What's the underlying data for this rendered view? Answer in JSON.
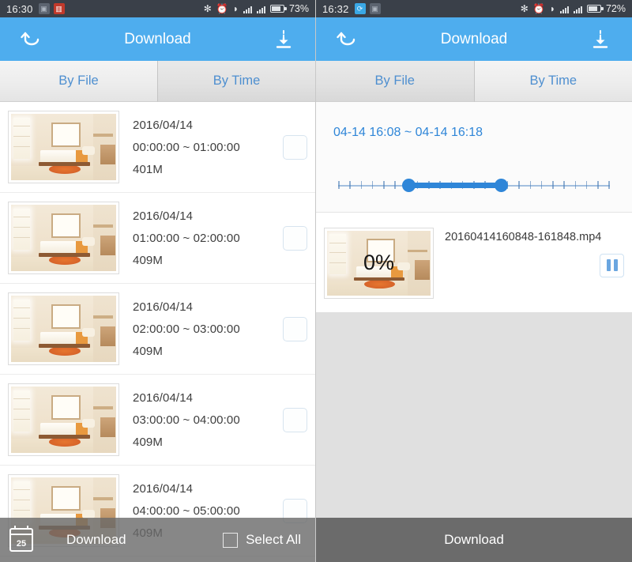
{
  "left": {
    "status_bar": {
      "time": "16:30",
      "icons": [
        "screenshot-icon",
        "calendar-icon"
      ],
      "right_icons": [
        "bluetooth-icon",
        "alarm-icon",
        "wifi-icon",
        "signal-icon",
        "signal-icon",
        "battery-icon"
      ],
      "battery_percent": "73%"
    },
    "header": {
      "back_icon": "back-arrow-icon",
      "title": "Download",
      "download_icon": "download-icon"
    },
    "tabs": [
      {
        "label": "By File",
        "selected": true
      },
      {
        "label": "By Time",
        "selected": false
      }
    ],
    "list": [
      {
        "date": "2016/04/14",
        "range": "00:00:00 ~ 01:00:00",
        "size": "401M",
        "checked": false
      },
      {
        "date": "2016/04/14",
        "range": "01:00:00 ~ 02:00:00",
        "size": "409M",
        "checked": false
      },
      {
        "date": "2016/04/14",
        "range": "02:00:00 ~ 03:00:00",
        "size": "409M",
        "checked": false
      },
      {
        "date": "2016/04/14",
        "range": "03:00:00 ~ 04:00:00",
        "size": "409M",
        "checked": false
      },
      {
        "date": "2016/04/14",
        "range": "04:00:00 ~ 05:00:00",
        "size": "409M",
        "checked": false
      }
    ],
    "bottom_bar": {
      "calendar_icon": "calendar-icon",
      "calendar_day": "25",
      "download_label": "Download",
      "select_all_label": "Select All",
      "select_all_checked": false
    }
  },
  "right": {
    "status_bar": {
      "time": "16:32",
      "icons": [
        "sync-icon",
        "screenshot-icon"
      ],
      "right_icons": [
        "bluetooth-icon",
        "alarm-icon",
        "wifi-icon",
        "signal-icon",
        "signal-icon",
        "battery-icon"
      ],
      "battery_percent": "72%"
    },
    "header": {
      "back_icon": "back-arrow-icon",
      "title": "Download",
      "download_icon": "download-icon"
    },
    "tabs": [
      {
        "label": "By File",
        "selected": false
      },
      {
        "label": "By Time",
        "selected": true
      }
    ],
    "time_range": {
      "label": "04-14 16:08 ~ 04-14 16:18",
      "start": "16:08",
      "end": "16:18",
      "tick_count": 25,
      "fill_start_percent": 26,
      "fill_end_percent": 60
    },
    "download_item": {
      "filename": "20160414160848-161848.mp4",
      "progress": "0%",
      "action_icon": "pause-icon"
    },
    "bottom_bar": {
      "download_label": "Download"
    }
  },
  "colors": {
    "header_blue": "#4eadee",
    "accent_blue": "#2f86d8",
    "tab_text": "#4e8fd0",
    "status_bar": "#3a4049",
    "bottom_bar": "#6b6b6b"
  }
}
